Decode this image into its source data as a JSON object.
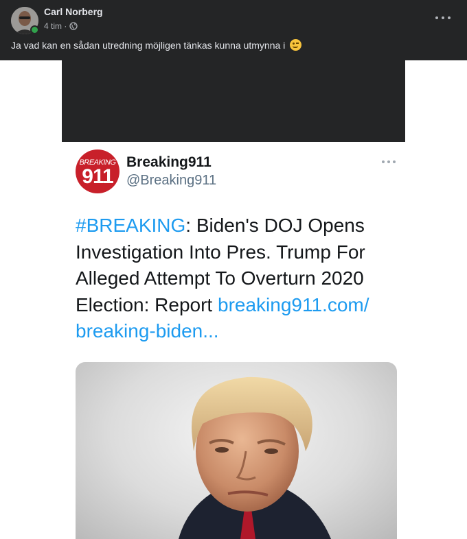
{
  "post": {
    "author": "Carl Norberg",
    "time": "4 tim ·",
    "text": "Ja vad kan en sådan utredning möjligen tänkas kunna utmynna i"
  },
  "icons": {
    "avatar": "profile-photo",
    "online": "online-status-dot",
    "audience": "globe-icon",
    "more": "more-options-icon",
    "emoji": "winking-face-emoji"
  },
  "tweet": {
    "avatar_top": "BREAKING",
    "avatar_num": "911",
    "name": "Breaking911",
    "handle": "@Breaking911",
    "hashtag": "#BREAKING",
    "body": ": Biden's DOJ Opens Investigation Into Pres. Trump For Alleged Attempt To Overturn 2020 Election: Report ",
    "link": "breaking911.com/ breaking-biden..."
  },
  "colors": {
    "fb_dark": "#242526",
    "fb_text": "#e4e6eb",
    "fb_secondary": "#b0b3b8",
    "online_green": "#31a24c",
    "twitter_link": "#1d9bf0",
    "breaking_red": "#c8202a"
  }
}
